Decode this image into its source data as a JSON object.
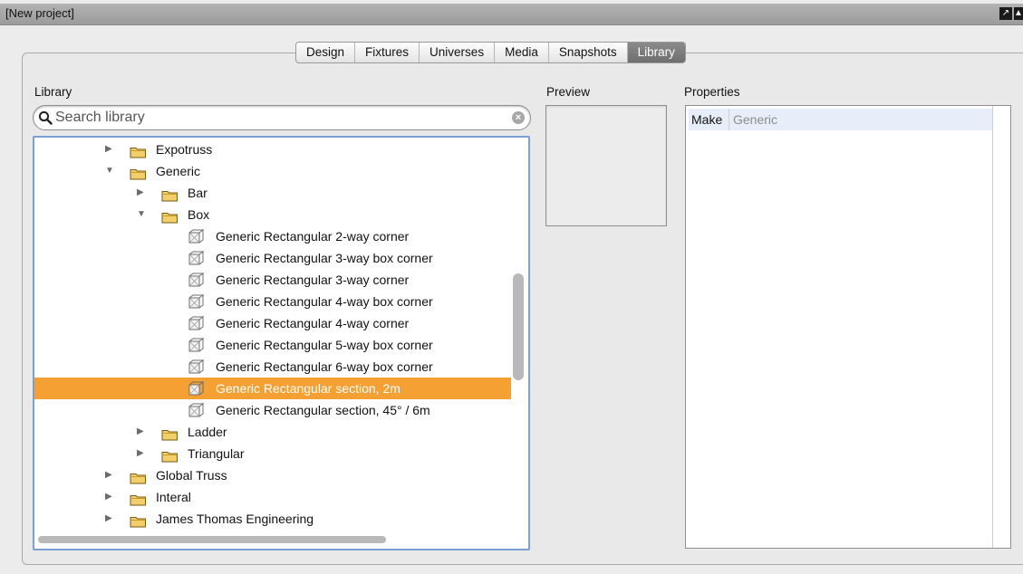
{
  "window": {
    "title": "[New project]"
  },
  "tabs": [
    {
      "label": "Design",
      "active": false
    },
    {
      "label": "Fixtures",
      "active": false
    },
    {
      "label": "Universes",
      "active": false
    },
    {
      "label": "Media",
      "active": false
    },
    {
      "label": "Snapshots",
      "active": false
    },
    {
      "label": "Library",
      "active": true
    }
  ],
  "library": {
    "label": "Library",
    "search": {
      "placeholder": "Search library",
      "value": ""
    },
    "tree": [
      {
        "label": "Expotruss",
        "type": "folder",
        "level": 1,
        "expanded": false
      },
      {
        "label": "Generic",
        "type": "folder",
        "level": 1,
        "expanded": true
      },
      {
        "label": "Bar",
        "type": "folder",
        "level": 2,
        "expanded": false
      },
      {
        "label": "Box",
        "type": "folder",
        "level": 2,
        "expanded": true
      },
      {
        "label": "Generic Rectangular 2-way corner",
        "type": "item",
        "level": 3
      },
      {
        "label": "Generic Rectangular 3-way box corner",
        "type": "item",
        "level": 3
      },
      {
        "label": "Generic Rectangular 3-way corner",
        "type": "item",
        "level": 3
      },
      {
        "label": "Generic Rectangular 4-way box corner",
        "type": "item",
        "level": 3
      },
      {
        "label": "Generic Rectangular 4-way corner",
        "type": "item",
        "level": 3
      },
      {
        "label": "Generic Rectangular 5-way box corner",
        "type": "item",
        "level": 3
      },
      {
        "label": "Generic Rectangular 6-way box corner",
        "type": "item",
        "level": 3
      },
      {
        "label": "Generic Rectangular section, 2m",
        "type": "item",
        "level": 3,
        "selected": true
      },
      {
        "label": "Generic Rectangular section, 45° / 6m",
        "type": "item",
        "level": 3
      },
      {
        "label": "Ladder",
        "type": "folder",
        "level": 2,
        "expanded": false
      },
      {
        "label": "Triangular",
        "type": "folder",
        "level": 2,
        "expanded": false
      },
      {
        "label": "Global Truss",
        "type": "folder",
        "level": 1,
        "expanded": false
      },
      {
        "label": "Interal",
        "type": "folder",
        "level": 1,
        "expanded": false
      },
      {
        "label": "James Thomas Engineering",
        "type": "folder",
        "level": 1,
        "expanded": false
      }
    ]
  },
  "preview": {
    "label": "Preview"
  },
  "properties": {
    "label": "Properties",
    "rows": [
      {
        "key": "Make",
        "value": "Generic"
      }
    ]
  },
  "colors": {
    "selection": "#f5a033",
    "focus_ring": "#7aa0d4",
    "active_tab": "#7a7a7a"
  },
  "icons": {
    "folder": "folder-icon",
    "item": "truss-icon",
    "search": "search-icon",
    "clear": "clear-search-icon"
  }
}
